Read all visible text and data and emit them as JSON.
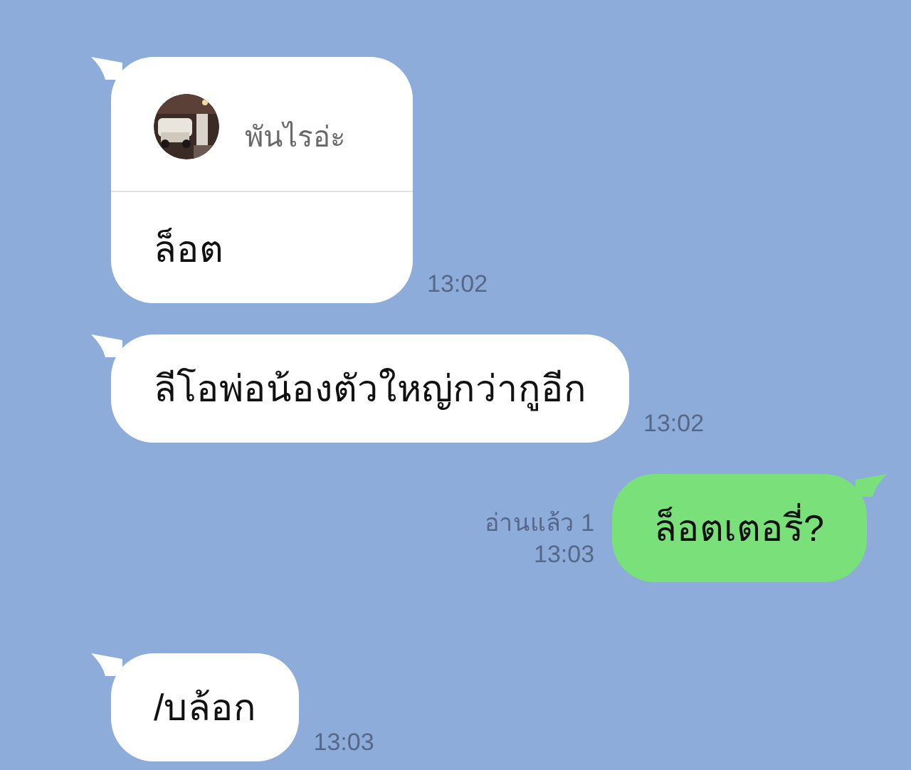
{
  "messages": [
    {
      "kind": "reply",
      "outgoing": false,
      "quote": {
        "author": "พันไรอ่ะ"
      },
      "text": "ล็อต",
      "time": "13:02"
    },
    {
      "kind": "text",
      "outgoing": false,
      "text": "ลีโอพ่อน้องตัวใหญ่กว่ากูอีก",
      "time": "13:02"
    },
    {
      "kind": "text",
      "outgoing": true,
      "text": "ล็อตเตอรี่?",
      "read": "อ่านแล้ว 1",
      "time": "13:03"
    },
    {
      "kind": "text",
      "outgoing": false,
      "text": "/บล้อก",
      "time": "13:03"
    }
  ]
}
